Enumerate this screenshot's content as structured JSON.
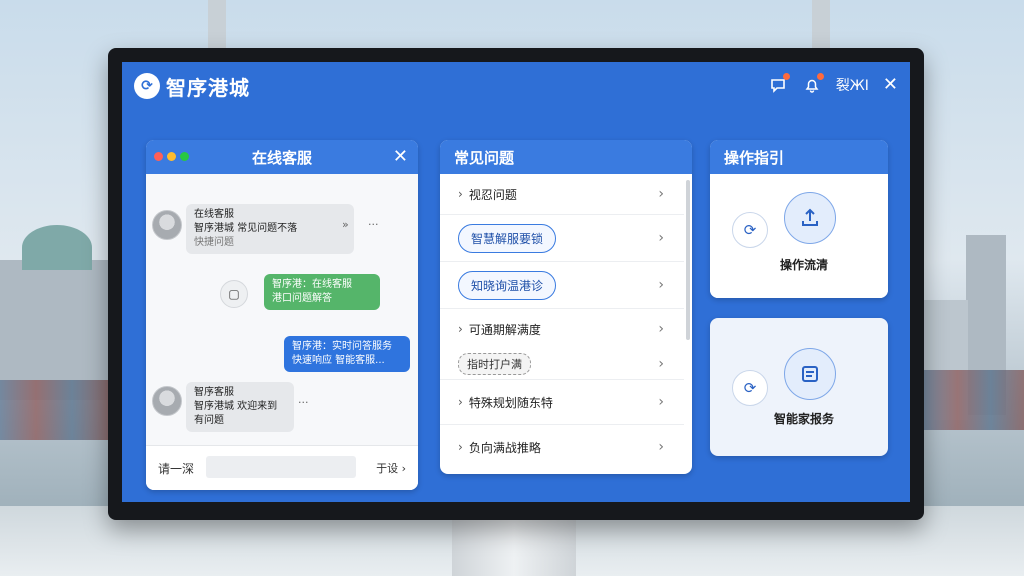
{
  "app": {
    "title": "智序港城",
    "logo_glyph": "⟳"
  },
  "titlebar": {
    "user_label": "裂ЖI",
    "close_glyph": "✕"
  },
  "chat": {
    "title": "在线客服",
    "dot_colors": [
      "#ff5f57",
      "#febc2e",
      "#28c840"
    ],
    "messages": [
      {
        "from": "agent",
        "lines": [
          "在线客服",
          "智序港城 常见问题不落",
          "快捷问题"
        ]
      },
      {
        "from": "user",
        "style": "green",
        "lines": [
          "智序港：在线客服",
          "港口问题解答"
        ]
      },
      {
        "from": "user",
        "style": "blue",
        "lines": [
          "智序港：实时问答服务",
          "快速响应 智能客服..."
        ]
      },
      {
        "from": "agent",
        "lines": [
          "智序客服",
          "智序港城 欢迎来到",
          "有问题"
        ]
      }
    ],
    "forward_glyph": "»",
    "more_glyph": "···",
    "input_label": "请一深",
    "input_placeholder": "",
    "send_label": "于设 ›"
  },
  "faq": {
    "title": "常见问题",
    "items": [
      {
        "label": "视忍问题",
        "kind": "plain"
      },
      {
        "label": "智慧解服要锁",
        "kind": "pill"
      },
      {
        "label": "知晓询温港诊",
        "kind": "pill"
      },
      {
        "label": "可通期解满度",
        "kind": "plain"
      },
      {
        "label": "指时打户满",
        "kind": "dashed"
      },
      {
        "label": "特殊规划随东特",
        "kind": "plain"
      },
      {
        "label": "负向满战推略",
        "kind": "plain"
      }
    ]
  },
  "guide": {
    "title": "操作指引",
    "card1_label": "操作流清",
    "card2_label": "智能家报务"
  },
  "colors": {
    "screen_blue": "#2f6fd6",
    "header_blue": "#3a7be0",
    "accent": "#2f74de"
  }
}
